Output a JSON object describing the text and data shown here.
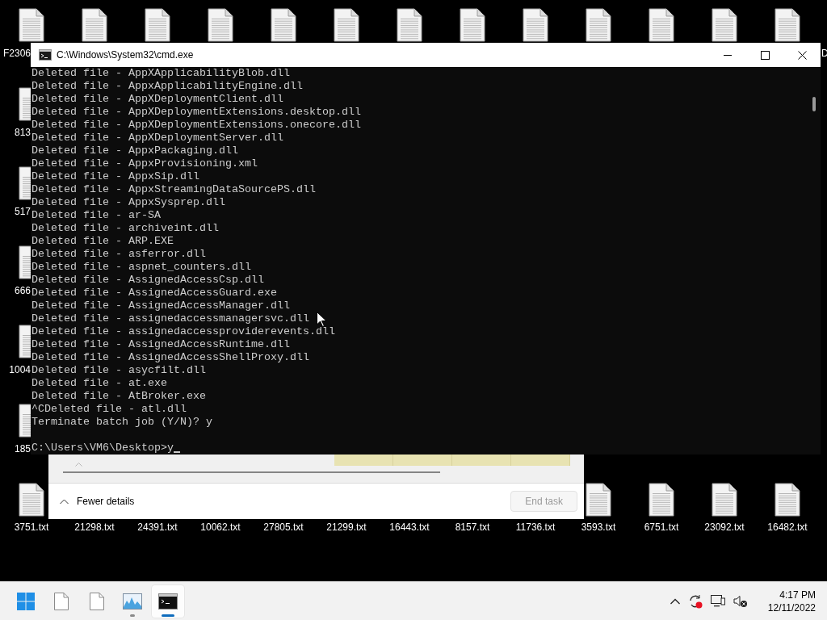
{
  "desktop": {
    "top_row": [
      {
        "kind": "file",
        "label": "F2306"
      },
      {
        "kind": "file"
      },
      {
        "kind": "file"
      },
      {
        "kind": "file"
      },
      {
        "kind": "file"
      },
      {
        "kind": "file"
      },
      {
        "kind": "file"
      },
      {
        "kind": "file"
      },
      {
        "kind": "file"
      },
      {
        "kind": "file"
      },
      {
        "kind": "file"
      },
      {
        "kind": "file"
      },
      {
        "kind": "file",
        "label": "D"
      }
    ],
    "left_column": [
      {
        "kind": "file",
        "label": "813"
      },
      {
        "kind": "file",
        "label": "517"
      },
      {
        "kind": "file",
        "label": "666"
      },
      {
        "kind": "file",
        "label": "1004"
      },
      {
        "kind": "file",
        "label": "185"
      }
    ],
    "bottom_row": [
      {
        "kind": "file",
        "label": "3751.txt"
      },
      {
        "kind": "covered",
        "label": "21298.txt"
      },
      {
        "kind": "covered",
        "label": "24391.txt"
      },
      {
        "kind": "covered",
        "label": "10062.txt"
      },
      {
        "kind": "covered",
        "label": "27805.txt"
      },
      {
        "kind": "covered",
        "label": "21299.txt"
      },
      {
        "kind": "covered",
        "label": "16443.txt"
      },
      {
        "kind": "covered",
        "label": "8157.txt"
      },
      {
        "kind": "covered",
        "label": "11736.txt"
      },
      {
        "kind": "file",
        "label": "3593.txt"
      },
      {
        "kind": "file",
        "label": "6751.txt"
      },
      {
        "kind": "file",
        "label": "23092.txt"
      },
      {
        "kind": "file",
        "label": "16482.txt"
      }
    ]
  },
  "cmd_window": {
    "title": "C:\\Windows\\System32\\cmd.exe",
    "lines": [
      "Deleted file - AppXApplicabilityBlob.dll",
      "Deleted file - AppxApplicabilityEngine.dll",
      "Deleted file - AppXDeploymentClient.dll",
      "Deleted file - AppXDeploymentExtensions.desktop.dll",
      "Deleted file - AppXDeploymentExtensions.onecore.dll",
      "Deleted file - AppXDeploymentServer.dll",
      "Deleted file - AppxPackaging.dll",
      "Deleted file - AppxProvisioning.xml",
      "Deleted file - AppxSip.dll",
      "Deleted file - AppxStreamingDataSourcePS.dll",
      "Deleted file - AppxSysprep.dll",
      "Deleted file - ar-SA",
      "Deleted file - archiveint.dll",
      "Deleted file - ARP.EXE",
      "Deleted file - asferror.dll",
      "Deleted file - aspnet_counters.dll",
      "Deleted file - AssignedAccessCsp.dll",
      "Deleted file - AssignedAccessGuard.exe",
      "Deleted file - AssignedAccessManager.dll",
      "Deleted file - assignedaccessmanagersvc.dll",
      "Deleted file - assignedaccessproviderevents.dll",
      "Deleted file - AssignedAccessRuntime.dll",
      "Deleted file - AssignedAccessShellProxy.dll",
      "Deleted file - asycfilt.dll",
      "Deleted file - at.exe",
      "Deleted file - AtBroker.exe",
      "^CDeleted file - atl.dll",
      "Terminate batch job (Y/N)? y"
    ],
    "prompt": "C:\\Users\\VM6\\Desktop>y"
  },
  "task_manager": {
    "details_toggle": "Fewer details",
    "end_task": {
      "label": "End task",
      "disabled": true
    }
  },
  "taskbar": {
    "apps": [
      {
        "kind": "start",
        "running": false,
        "active": false
      },
      {
        "kind": "file",
        "running": false,
        "active": false
      },
      {
        "kind": "file",
        "running": false,
        "active": false
      },
      {
        "kind": "monitor",
        "running": true,
        "active": false
      },
      {
        "kind": "terminal",
        "running": true,
        "active": true
      }
    ],
    "tray": [
      {
        "kind": "chevron"
      },
      {
        "kind": "sync"
      },
      {
        "kind": "network"
      },
      {
        "kind": "muted"
      }
    ],
    "clock": {
      "time": "4:17 PM",
      "date": "12/11/2022"
    }
  }
}
